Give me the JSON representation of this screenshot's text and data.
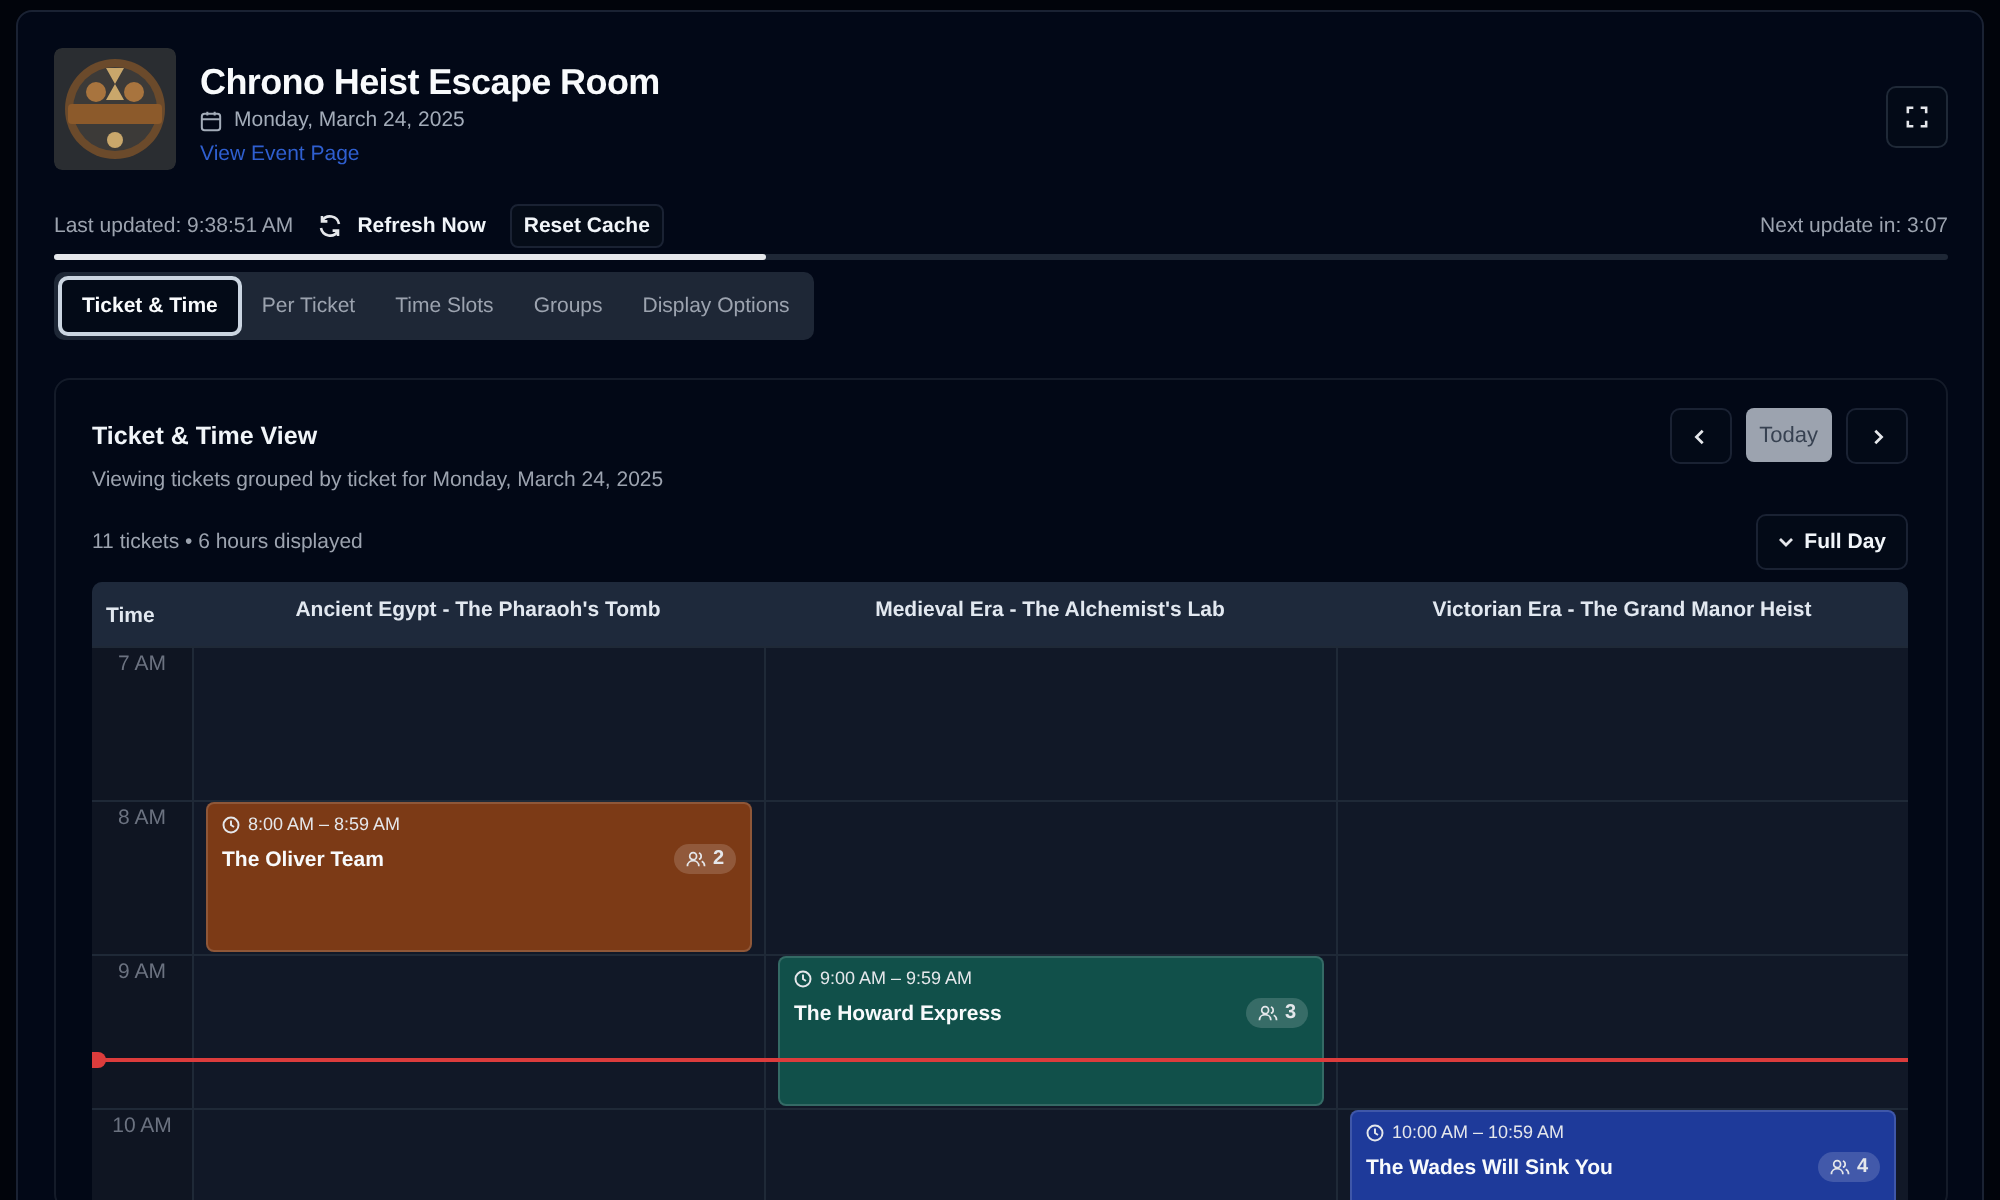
{
  "event": {
    "title": "Chrono Heist Escape Room",
    "date": "Monday, March 24, 2025",
    "link": "View Event Page"
  },
  "refresh": {
    "last_updated": "Last updated: 9:38:51 AM",
    "refresh_button": "Refresh Now",
    "reset_button": "Reset Cache",
    "next_update": "Next update in: 3:07",
    "level": 0.376
  },
  "tabs": [
    {
      "label": "Ticket & Time",
      "selected": true
    },
    {
      "label": "Per Ticket",
      "selected": false
    },
    {
      "label": "Time Slots",
      "selected": false
    },
    {
      "label": "Groups",
      "selected": false
    },
    {
      "label": "Display Options",
      "selected": false
    }
  ],
  "view": {
    "title": "Ticket & Time View",
    "subtitle": "Viewing tickets grouped by ticket for Monday, March 24, 2025",
    "summary": "11 tickets • 6 hours displayed",
    "today_button": "Today",
    "range_button": "Full Day"
  },
  "schedule": {
    "time_heading": "Time",
    "columns": [
      "Ancient Egypt - The Pharaoh's Tomb",
      "Medieval Era - The Alchemist's Lab",
      "Victorian Era - The Grand Manor Heist"
    ],
    "rows": [
      {
        "time": "7 AM",
        "now": false,
        "cells": [
          {
            "kind": "empty"
          },
          {
            "kind": "empty"
          },
          {
            "kind": "empty"
          }
        ]
      },
      {
        "time": "8 AM",
        "now": false,
        "cells": [
          {
            "kind": "booking",
            "time": "8:00 AM – 8:59 AM",
            "name": "The Oliver Team",
            "guests": "2",
            "color": "#7c3a16"
          },
          {
            "kind": "empty"
          },
          {
            "kind": "empty"
          }
        ]
      },
      {
        "time": "9 AM",
        "now": true,
        "cells": [
          {
            "kind": "empty"
          },
          {
            "kind": "booking",
            "time": "9:00 AM – 9:59 AM",
            "name": "The Howard Express",
            "guests": "3",
            "color": "#11504a"
          },
          {
            "kind": "empty"
          }
        ]
      },
      {
        "time": "10 AM",
        "now": false,
        "cells": [
          {
            "kind": "empty"
          },
          {
            "kind": "empty"
          },
          {
            "kind": "booking",
            "time": "10:00 AM – 10:59 AM",
            "name": "The Wades Will Sink You",
            "guests": "4",
            "color": "#1e3a9a"
          }
        ]
      }
    ]
  }
}
